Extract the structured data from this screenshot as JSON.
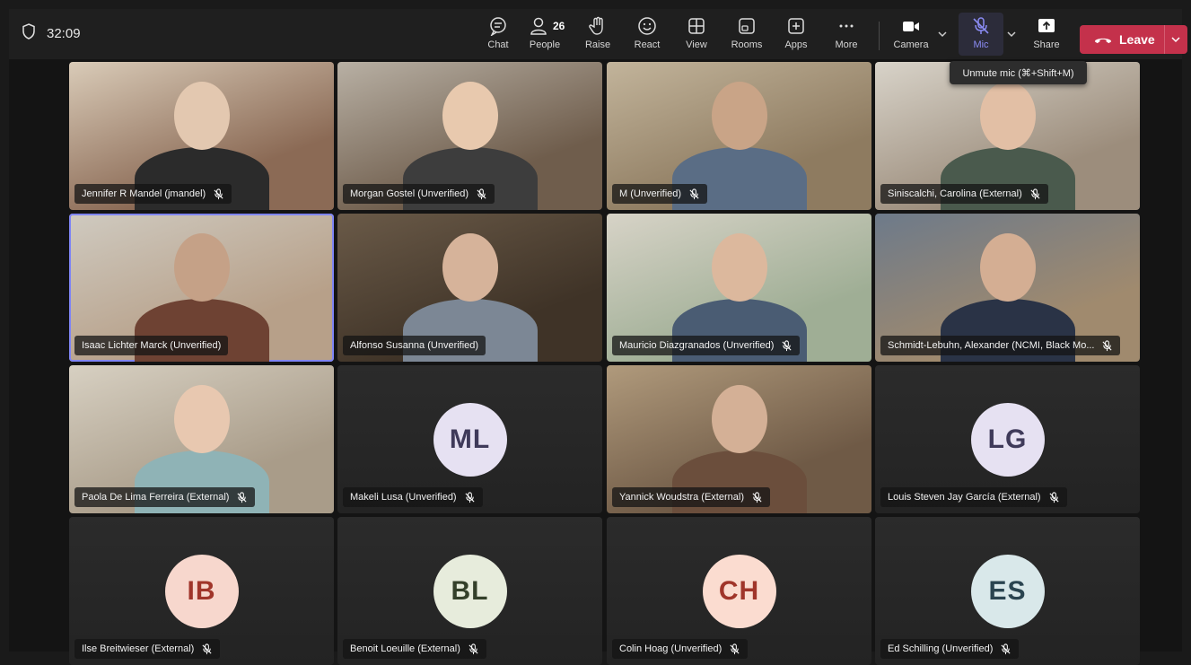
{
  "timer": "32:09",
  "toolbar": {
    "chat": "Chat",
    "people": "People",
    "people_count": "26",
    "raise": "Raise",
    "react": "React",
    "view": "View",
    "rooms": "Rooms",
    "apps": "Apps",
    "more": "More",
    "camera": "Camera",
    "mic": "Mic",
    "share": "Share",
    "leave": "Leave"
  },
  "tooltip": "Unmute mic (⌘+Shift+M)",
  "colors": {
    "accent": "#7f85f5",
    "leave": "#c4314b"
  },
  "participants": [
    {
      "name": "Jennifer R Mandel (jmandel)",
      "muted": true,
      "video": true
    },
    {
      "name": "Morgan Gostel (Unverified)",
      "muted": true,
      "video": true
    },
    {
      "name": "M (Unverified)",
      "muted": true,
      "video": true
    },
    {
      "name": "Siniscalchi, Carolina (External)",
      "muted": true,
      "video": true
    },
    {
      "name": "Isaac Lichter Marck (Unverified)",
      "muted": false,
      "video": true,
      "speaking": true
    },
    {
      "name": "Alfonso Susanna (Unverified)",
      "muted": false,
      "video": true
    },
    {
      "name": "Mauricio Diazgranados (Unverified)",
      "muted": true,
      "video": true
    },
    {
      "name": "Schmidt-Lebuhn, Alexander (NCMI, Black Mo...",
      "muted": true,
      "video": true
    },
    {
      "name": "Paola De Lima Ferreira (External)",
      "muted": true,
      "video": true
    },
    {
      "name": "Makeli Lusa (Unverified)",
      "muted": true,
      "video": false,
      "initials": "ML"
    },
    {
      "name": "Yannick Woudstra (External)",
      "muted": true,
      "video": true
    },
    {
      "name": "Louis Steven Jay García (External)",
      "muted": true,
      "video": false,
      "initials": "LG"
    },
    {
      "name": "Ilse Breitwieser (External)",
      "muted": true,
      "video": false,
      "initials": "IB"
    },
    {
      "name": "Benoit Loeuille (External)",
      "muted": true,
      "video": false,
      "initials": "BL"
    },
    {
      "name": "Colin Hoag (Unverified)",
      "muted": true,
      "video": false,
      "initials": "CH"
    },
    {
      "name": "Ed Schilling (Unverified)",
      "muted": true,
      "video": false,
      "initials": "ES"
    }
  ]
}
